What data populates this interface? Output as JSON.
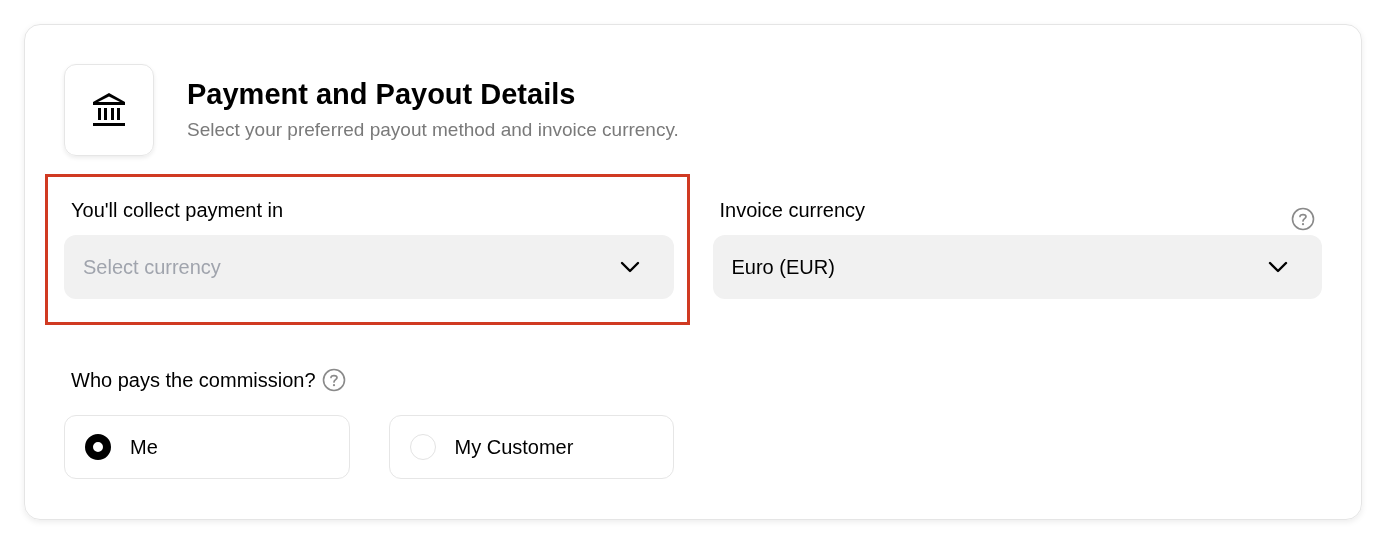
{
  "header": {
    "title": "Payment and Payout Details",
    "subtitle": "Select your preferred payout method and invoice currency."
  },
  "fields": [
    {
      "label": "You'll collect payment in",
      "placeholder": "Select currency",
      "help": false,
      "highlighted": true
    },
    {
      "label": "Invoice currency",
      "value": "Euro (EUR)",
      "help": true,
      "highlighted": false
    }
  ],
  "commission": {
    "label": "Who pays the commission?",
    "help": true,
    "options": [
      {
        "label": "Me",
        "selected": true
      },
      {
        "label": "My Customer",
        "selected": false
      }
    ]
  }
}
